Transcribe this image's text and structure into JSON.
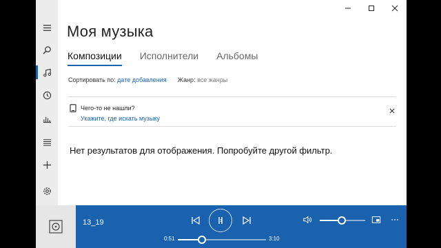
{
  "app": {
    "page_title": "Моя музыка"
  },
  "rail": {
    "items": [
      {
        "name": "menu",
        "icon": "hamburger-icon"
      },
      {
        "name": "search",
        "icon": "search-icon"
      },
      {
        "name": "my-music",
        "icon": "music-note-icon",
        "active": true
      },
      {
        "name": "recent",
        "icon": "clock-icon"
      },
      {
        "name": "now-playing",
        "icon": "equalizer-icon"
      },
      {
        "name": "playlists",
        "icon": "playlist-icon"
      },
      {
        "name": "new-playlist",
        "icon": "plus-icon"
      },
      {
        "name": "settings",
        "icon": "gear-icon"
      }
    ]
  },
  "tabs": [
    {
      "label": "Композиции",
      "active": true
    },
    {
      "label": "Исполнители",
      "active": false
    },
    {
      "label": "Альбомы",
      "active": false
    }
  ],
  "filters": {
    "sort_label": "Сортировать по:",
    "sort_value": "дате добавления",
    "genre_label": "Жанр:",
    "genre_value": "все жанры"
  },
  "info_bar": {
    "title": "Чего-то не нашли?",
    "link": "Укажите, где искать музыку"
  },
  "empty_message": "Нет результатов для отображения. Попробуйте другой фильтр.",
  "player": {
    "track": "13_19",
    "elapsed": "0:51",
    "total": "3:10",
    "progress": 0.27,
    "volume": 0.48
  },
  "colors": {
    "accent": "#1a62ad",
    "rail_bg": "#ececec",
    "page_bg": "#ffffff"
  }
}
